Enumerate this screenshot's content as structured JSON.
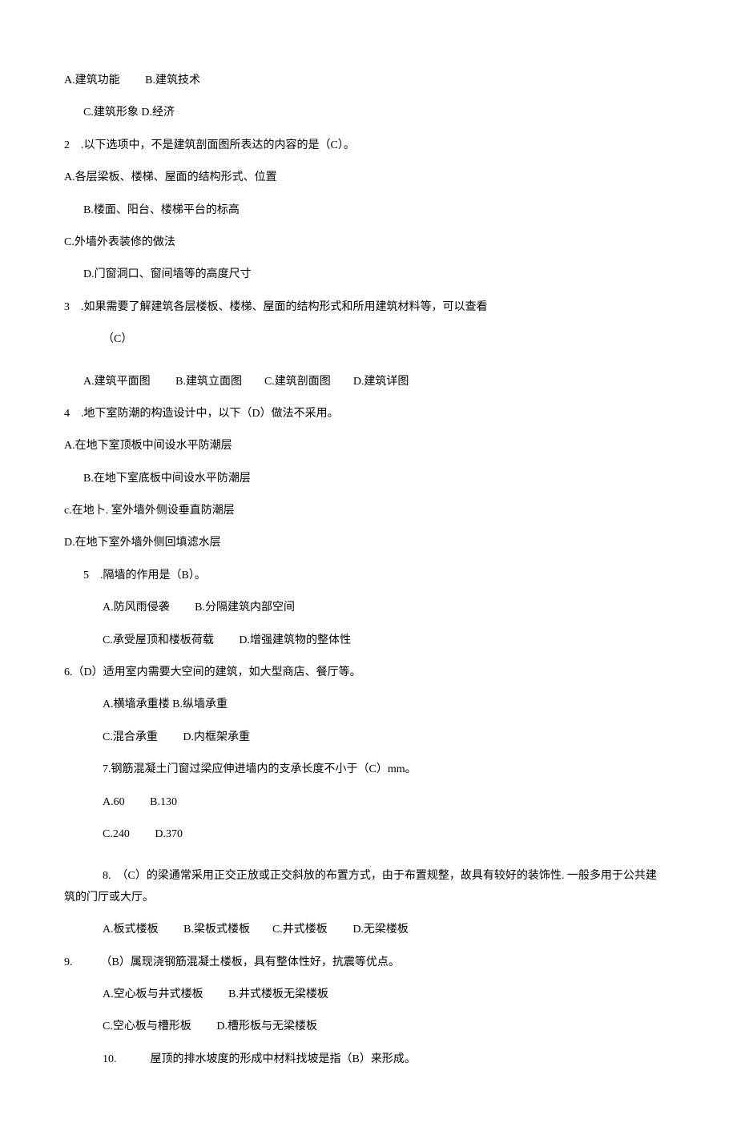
{
  "q1": {
    "optA": "A.建筑功能",
    "optB": "B.建筑技术",
    "optC": "C.建筑形象",
    "optD": "D.经济"
  },
  "q2": {
    "stem": "2　.以下选项中，不是建筑剖面图所表达的内容的是（C）。",
    "optA": "A.各层梁板、楼梯、屋面的结构形式、位置",
    "optB": "B.楼面、阳台、楼梯平台的标高",
    "optC": "C.外墙外表装修的做法",
    "optD": "D.门窗洞口、窗间墙等的高度尺寸"
  },
  "q3": {
    "stem": "3　.如果需要了解建筑各层楼板、楼梯、屋面的结构形式和所用建筑材料等，可以查看",
    "stem2": "（C）",
    "optA": "A.建筑平面图",
    "optB": "B.建筑立面图",
    "optC": "C.建筑剖面图",
    "optD": "D.建筑详图"
  },
  "q4": {
    "stem": "4　.地下室防潮的构造设计中，以下（D）做法不采用。",
    "optA": "A.在地下室顶板中间设水平防潮层",
    "optB": "B.在地下室底板中间设水平防潮层",
    "optC": "c.在地卜. 室外墙外侧设垂直防潮层",
    "optD": "D.在地下室外墙外侧回填滤水层"
  },
  "q5": {
    "stem": "5　.隔墙的作用是（B）。",
    "optA": "A.防风雨侵袭",
    "optB": "B.分隔建筑内部空间",
    "optC": "C.承受屋顶和楼板荷载",
    "optD": "D.增强建筑物的整体性"
  },
  "q6": {
    "stem": "6.（D）适用室内需要大空间的建筑，如大型商店、餐厅等。",
    "optA": "A.横墙承重楼",
    "optB": "B.纵墙承重",
    "optC": "C.混合承重",
    "optD": "D.内框架承重"
  },
  "q7": {
    "stem": "7.钢筋混凝土门窗过梁应伸进墙内的支承长度不小于（C）mm。",
    "optA": "A.60",
    "optB": "B.130",
    "optC": "C.240",
    "optD": "D.370"
  },
  "q8": {
    "stem1": "8.　（C）的梁通常采用正交正放或正交斜放的布置方式，由于布置规整，故具有较好的装饰性. 一般多用于公共建",
    "stem2": "筑的门厅或大厅。",
    "optA": "A.板式楼板",
    "optB": "B.梁板式楼板",
    "optC": "C.井式楼板",
    "optD": "D.无梁楼板"
  },
  "q9": {
    "stem": "9.　　　（B）属现浇钢筋混凝土楼板，具有整体性好，抗震等优点。",
    "optA": "A.空心板与井式楼板",
    "optB": "B.井式楼板无梁楼板",
    "optC": "C.空心板与槽形板",
    "optD": "D.槽形板与无梁楼板"
  },
  "q10": {
    "stem": "10.　　　屋顶的排水坡度的形成中材料找坡是指（B）来形成。"
  }
}
